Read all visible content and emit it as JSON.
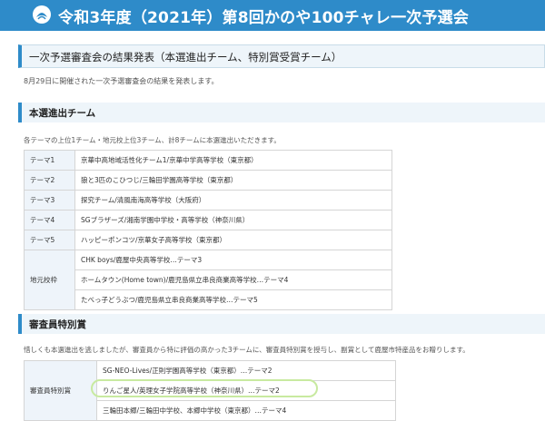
{
  "header": {
    "title": "令和3年度（2021年）第8回かのや100チャレ一次予選会",
    "logo_icon": "flower-logo-icon"
  },
  "results_box": {
    "title": "一次予選審査会の結果発表（本選進出チーム、特別賞受賞チーム）"
  },
  "intro_text": "8月29日に開催された一次予選審査会の結果を発表します。",
  "finalists": {
    "heading": "本選進出チーム",
    "note": "各テーマの上位1チーム・地元校上位3チーム、計8チームに本選進出いただきます。",
    "rows": [
      {
        "label": "テーマ1",
        "value": "京華中高地域活性化チーム1/京華中学高等学校（東京都）"
      },
      {
        "label": "テーマ2",
        "value": "狼と3匹のこひつじ/三輪田学園高等学校（東京都）"
      },
      {
        "label": "テーマ3",
        "value": "探究チーム/清風南海高等学校（大阪府）"
      },
      {
        "label": "テーマ4",
        "value": "SGブラザーズ/湘南学園中学校・高等学校（神奈川県）"
      },
      {
        "label": "テーマ5",
        "value": "ハッピーポンコツ/京華女子高等学校（東京都）"
      }
    ],
    "local_label": "地元校枠",
    "local_rows": [
      "CHK boys/鹿屋中央高等学校…テーマ3",
      "ホームタウン(Home town)/鹿児島県立串良商業高等学校…テーマ4",
      "たべっ子どうぶつ/鹿児島県立串良商業高等学校…テーマ5"
    ]
  },
  "special": {
    "heading": "審査員特別賞",
    "note": "惜しくも本選進出を逃しましたが、審査員から特に評価の高かった3チームに、審査員特別賞を授与し、副賞として鹿屋市特産品をお贈りします。",
    "label": "審査員特別賞",
    "rows": [
      "SG-NEO-Lives/正則学園高等学校（東京都）…テーマ2",
      "りんご星人/英理女子学院高等学校（神奈川県）…テーマ2",
      "三輪田本郷/三輪田中学校、本郷中学校（東京都）…テーマ4"
    ]
  },
  "colors": {
    "brand": "#2e8bc9",
    "panel": "#eef5fa",
    "highlight": "#c8eaa0"
  }
}
